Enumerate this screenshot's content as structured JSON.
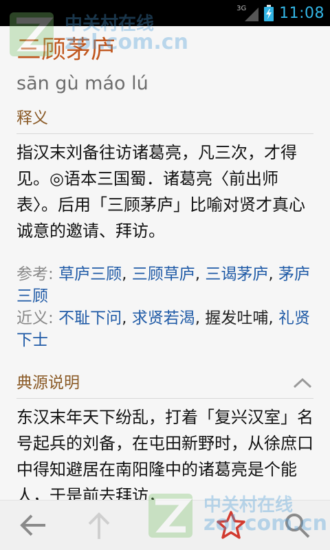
{
  "status_bar": {
    "network": "3G",
    "time": "11:08"
  },
  "entry": {
    "title": "三顾茅庐",
    "pinyin": "sān gù máo lú",
    "definition_heading": "释义",
    "definition_text": "指汉末刘备往访诸葛亮，凡三次，才得见。◎语本三国蜀．诸葛亮〈前出师表〉。后用「三顾茅庐」比喻对贤才真心诚意的邀请、拜访。",
    "refs_label": "参考:",
    "refs": [
      "草庐三顾",
      "三顾草庐",
      "三谒茅庐",
      "茅庐三顾"
    ],
    "synonyms_label": "近义:",
    "synonyms": [
      "不耻下问",
      "求贤若渴",
      "握发吐哺",
      "礼贤下士"
    ],
    "source_heading": "典源说明",
    "source_text": "东汉末年天下纷乱，打着「复兴汉室」名号起兵的刘备，在屯田新野时，从徐庶口中得知避居在南阳隆中的诸葛亮是个能人，于是前去拜访，"
  },
  "watermark": {
    "line1": "中关村在线",
    "line2": "zol.com.cn"
  },
  "colors": {
    "title": "#c0561d",
    "heading": "#8a5a26",
    "link": "#1f5aa6",
    "clock": "#33b5e5"
  },
  "action_bar": {
    "icons": [
      "back-arrow-icon",
      "up-arrow-icon",
      "star-icon",
      "search-icon"
    ]
  }
}
